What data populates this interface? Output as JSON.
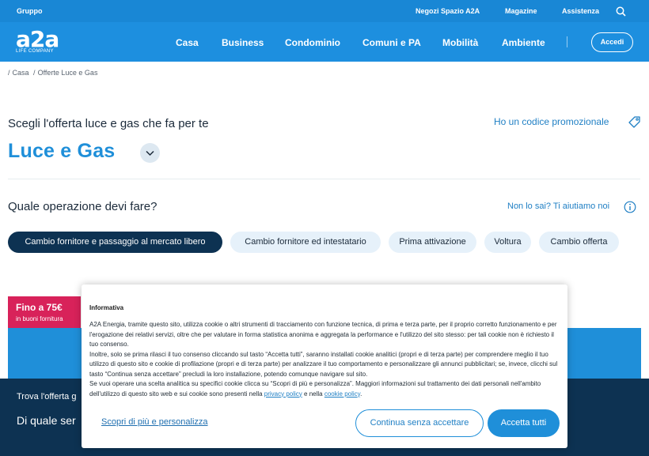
{
  "topbar": {
    "group": "Gruppo",
    "links": [
      "Negozi Spazio A2A",
      "Magazine",
      "Assistenza"
    ]
  },
  "logo": {
    "mark": "a2a",
    "tagline": "LIFE COMPANY"
  },
  "nav": {
    "items": [
      "Casa",
      "Business",
      "Condominio",
      "Comuni e PA",
      "Mobilità",
      "Ambiente"
    ],
    "login": "Accedi"
  },
  "breadcrumb": [
    "Casa",
    "Offerte Luce e Gas"
  ],
  "selector": {
    "intro": "Scegli l'offerta luce e gas che fa per te",
    "promo": "Ho un codice promozionale",
    "product": "Luce e Gas"
  },
  "operation": {
    "question": "Quale operazione devi fare?",
    "help": "Non lo sai? Ti aiutiamo noi",
    "chips": [
      "Cambio fornitore e passaggio al mercato libero",
      "Cambio fornitore ed intestatario",
      "Prima attivazione",
      "Voltura",
      "Cambio offerta"
    ]
  },
  "card": {
    "badge_title": "Fino a 75€",
    "badge_sub": "in buoni fornitura"
  },
  "bottom": {
    "line1": "Trova l'offerta g",
    "line2": "Di quale ser"
  },
  "cookie": {
    "title": "Informativa",
    "p1": "A2A Energia, tramite questo sito, utilizza cookie o altri strumenti di tracciamento con funzione tecnica, di prima e terza parte, per il proprio corretto funzionamento e per l'erogazione dei relativi servizi, oltre che per valutare in forma statistica anonima e aggregata la performance e l'utilizzo del sito stesso: per tali cookie non è richiesto il tuo consenso.",
    "p2": "Inoltre, solo se prima rilasci il tuo consenso cliccando sul tasto “Accetta tutti”, saranno installati cookie analitici (propri e di terza parte) per comprendere meglio il tuo utilizzo di questo sito e cookie di profilazione (propri e di terza parte) per analizzare il tuo comportamento e personalizzare gli annunci pubblicitari; se, invece, clicchi sul tasto “Continua senza accettare” precludi la loro installazione, potendo comunque navigare sul sito.",
    "p3": "Se vuoi operare una scelta analitica su specifici cookie clicca su “Scopri di più e personalizza”. Maggiori informazioni sul trattamento dei dati personali nell'ambito dell'utilizzo di questo sito web e sui cookie sono presenti nella",
    "privacy_link": "privacy policy",
    "and": "e nella",
    "cookie_link": "cookie policy",
    "end": ".",
    "more": "Scopri di più e personalizza",
    "continue": "Continua senza accettare",
    "accept": "Accetta tutti"
  },
  "colors": {
    "brand_blue": "#1d8fdf",
    "navy": "#0d3252",
    "promo_pink": "#d8225a"
  }
}
